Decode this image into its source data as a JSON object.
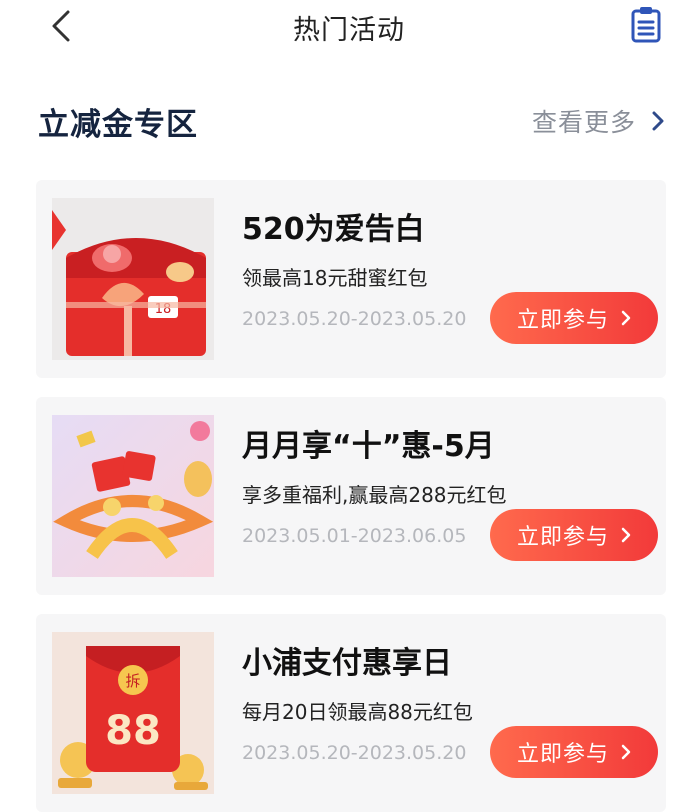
{
  "nav": {
    "title": "热门活动",
    "back_icon": "chevron-left-icon",
    "clipboard_icon": "clipboard-icon"
  },
  "section": {
    "title": "立减金专区",
    "more_label": "查看更多"
  },
  "colors": {
    "accent": "#f23a3a",
    "section_title": "#15243f"
  },
  "cards": [
    {
      "title": "520为爱告白",
      "subtitle": "领最高18元甜蜜红包",
      "date": "2023.05.20-2023.05.20",
      "button": "立即参与"
    },
    {
      "title": "月月享“十”惠-5月",
      "subtitle": "享多重福利,赢最高288元红包",
      "date": "2023.05.01-2023.06.05",
      "button": "立即参与"
    },
    {
      "title": "小浦支付惠享日",
      "subtitle": "每月20日领最高88元红包",
      "date": "2023.05.20-2023.05.20",
      "button": "立即参与"
    }
  ],
  "thumbs": {
    "card1_badge": "18",
    "card3_top": "拆",
    "card3_amount": "88"
  }
}
